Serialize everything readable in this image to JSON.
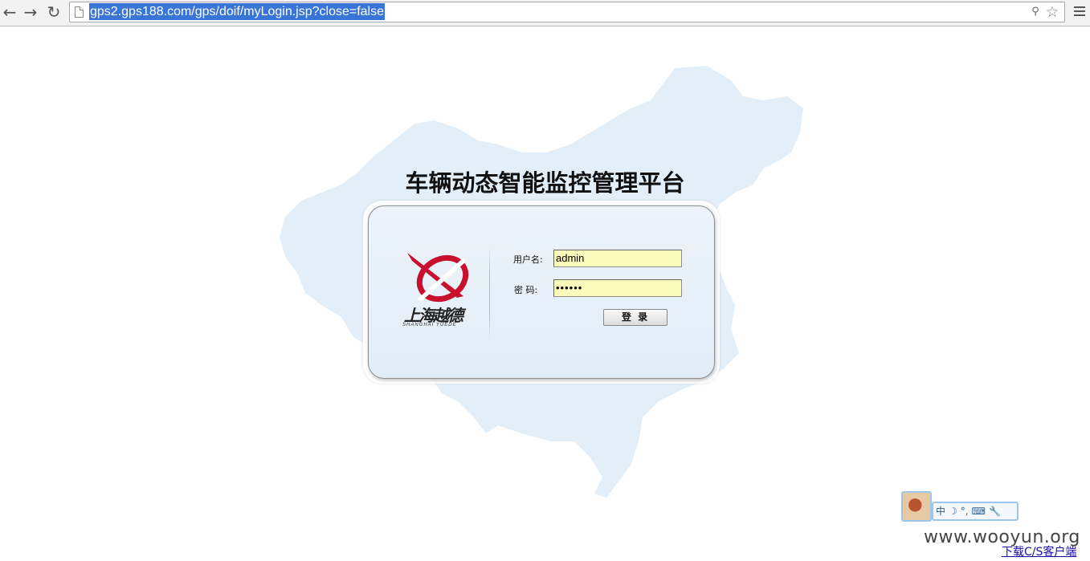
{
  "browser": {
    "url": "gps2.gps188.com/gps/doif/myLogin.jsp?close=false"
  },
  "page": {
    "title": "车辆动态智能监控管理平台",
    "logo_text": "上海越德",
    "logo_subtext": "SHANGHAI  YUEDE"
  },
  "login": {
    "username_label": "用户名:",
    "username_value": "admin",
    "password_label": "密  码:",
    "password_value": "••••••",
    "submit_label": "登 录"
  },
  "ime": {
    "mode": "中",
    "moon": "☽",
    "punct": "°,",
    "keyboard": "⌨",
    "tool": "🔧"
  },
  "watermark": "www.wooyun.org",
  "footer_link": "下载C/S客户端",
  "colors": {
    "map_fill": "#e2eef8",
    "brand_red": "#c8102e",
    "input_bg": "#fafaba",
    "selection": "#3875d7"
  }
}
